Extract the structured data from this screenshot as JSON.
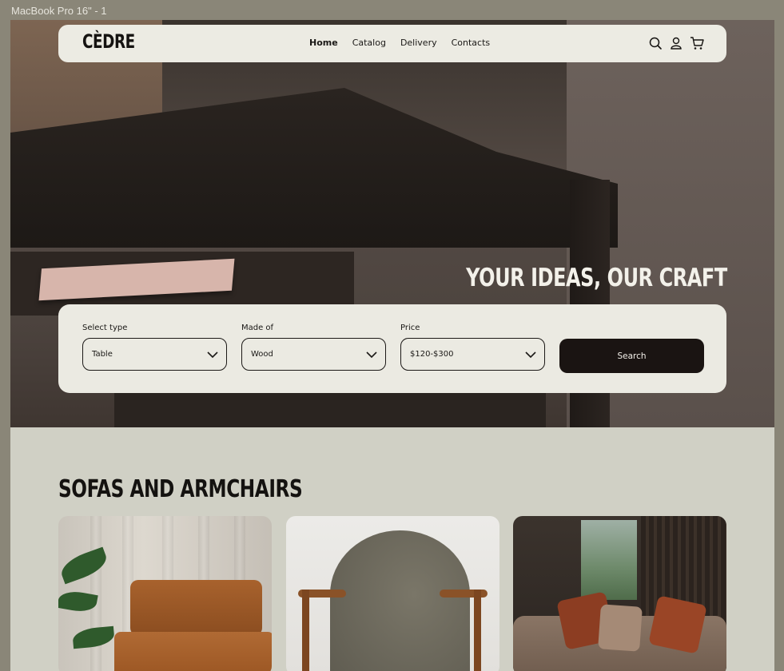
{
  "frame_label": "MacBook Pro 16\" - 1",
  "brand": {
    "logo": "CÈDRE"
  },
  "nav": {
    "links": [
      "Home",
      "Catalog",
      "Delivery",
      "Contacts"
    ],
    "active": "Home",
    "icons": [
      "search-icon",
      "user-icon",
      "cart-icon"
    ]
  },
  "hero": {
    "title": "YOUR IDEAS, OUR CRAFT"
  },
  "search": {
    "fields": [
      {
        "label": "Select type",
        "value": "Table"
      },
      {
        "label": "Made of",
        "value": "Wood"
      },
      {
        "label": "Price",
        "value": "$120-$300"
      }
    ],
    "button_label": "Search"
  },
  "section": {
    "title": "SOFAS AND ARMCHAIRS",
    "products": [
      "leather-armchair",
      "upholstered-chair",
      "sofa-with-pillows"
    ]
  },
  "colors": {
    "frame": "#8a8678",
    "section_bg": "#d0d0c5",
    "panel_bg": "#ecebe3",
    "button_bg": "#1a1412",
    "text": "#1a1816"
  }
}
